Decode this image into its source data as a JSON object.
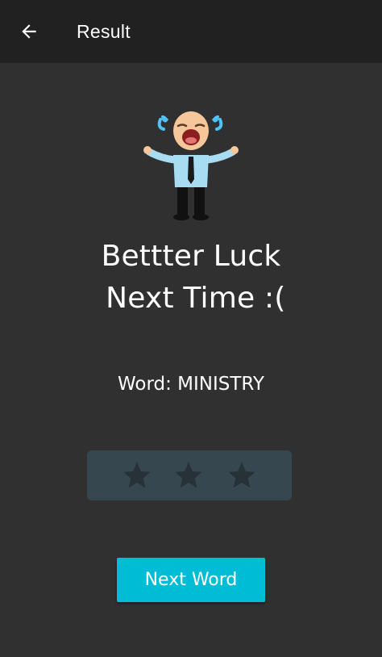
{
  "toolbar": {
    "title": "Result",
    "back_icon": "arrow-back-icon"
  },
  "illustration": {
    "icon": "crying-businessman-icon"
  },
  "result": {
    "headline": "Bettter Luck\n Next Time :(",
    "word_line": "Word: MINISTRY"
  },
  "rating": {
    "stars_total": 3,
    "stars_filled": 0,
    "star_color": "#263238",
    "background_color": "#37474f"
  },
  "actions": {
    "next_word_label": "Next Word"
  },
  "colors": {
    "background": "#303030",
    "toolbar": "#212121",
    "accent": "#00bcd4"
  }
}
